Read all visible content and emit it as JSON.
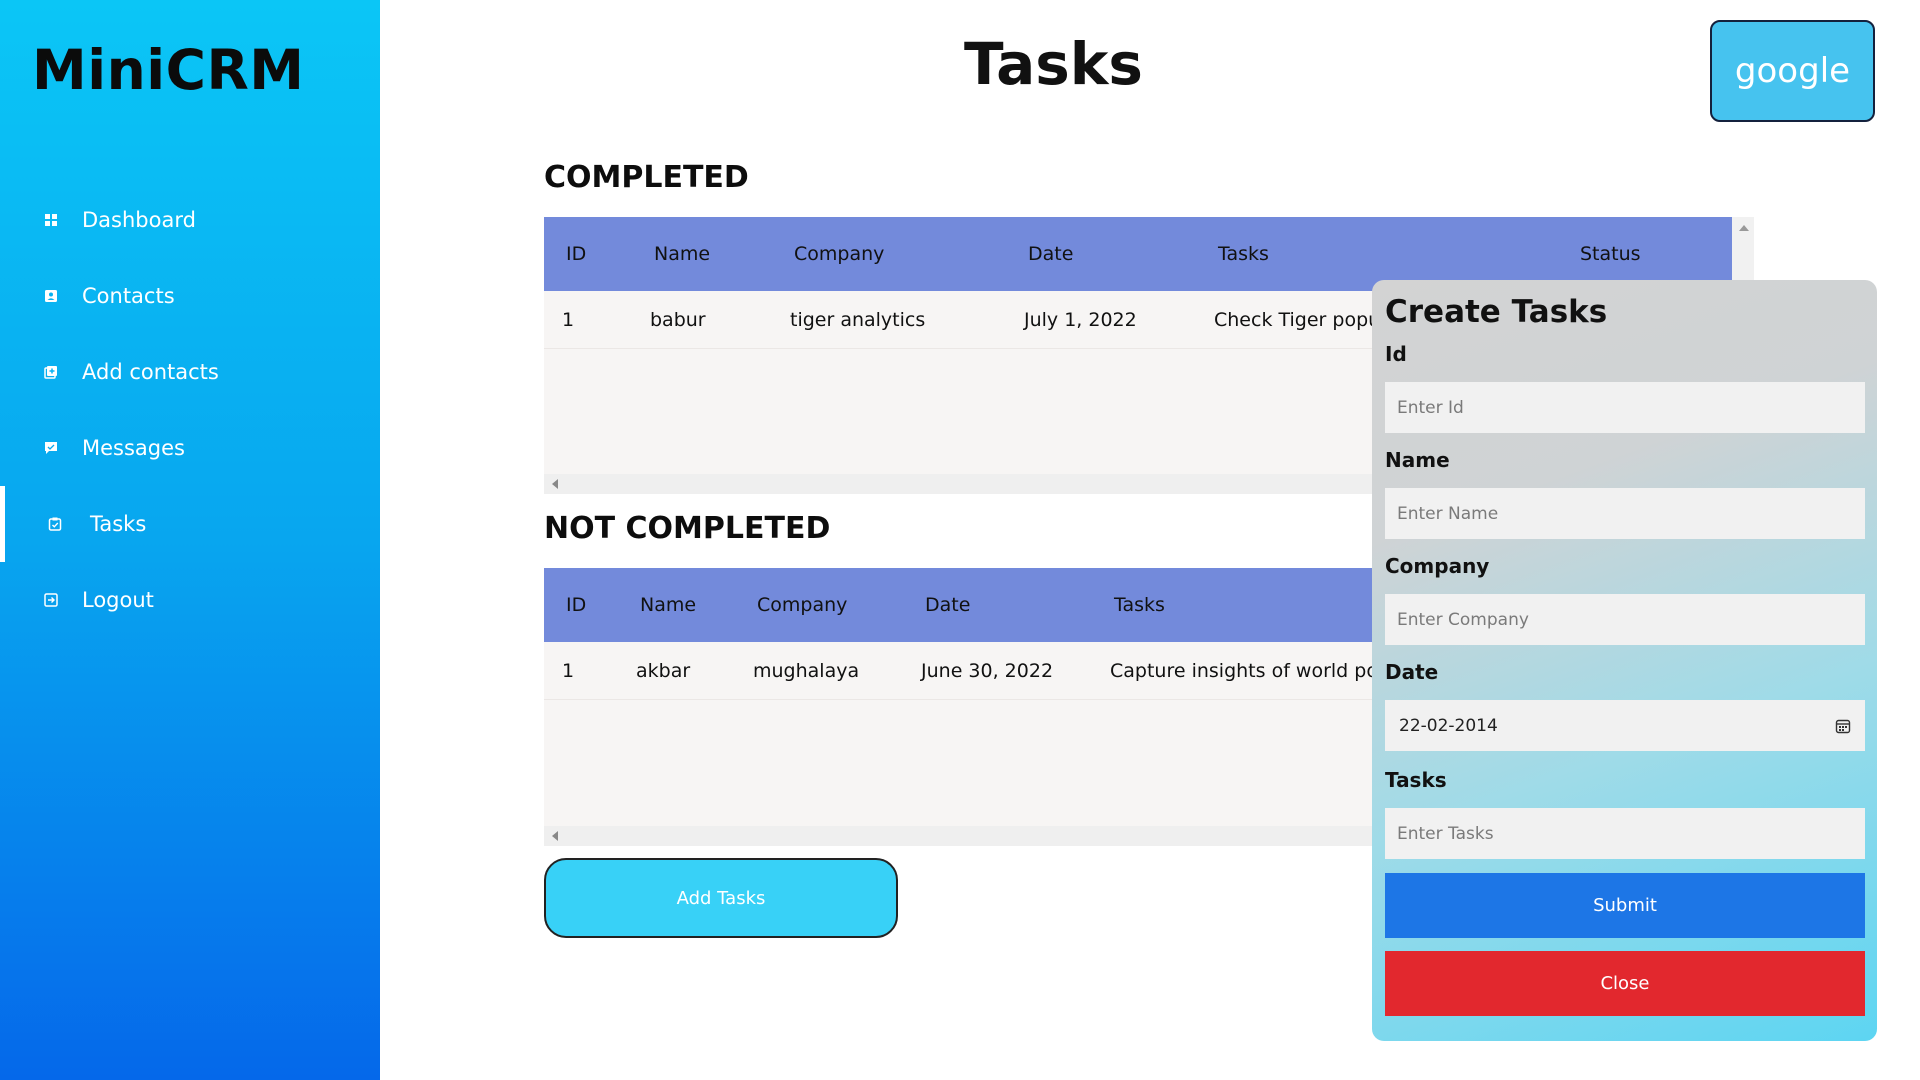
{
  "app": {
    "brand": "MiniCRM",
    "page_title": "Tasks",
    "google_button": "google"
  },
  "sidebar": {
    "items": [
      {
        "label": "Dashboard",
        "icon": "dashboard-icon"
      },
      {
        "label": "Contacts",
        "icon": "contact-card-icon"
      },
      {
        "label": "Add contacts",
        "icon": "add-contact-icon"
      },
      {
        "label": "Messages",
        "icon": "message-icon"
      },
      {
        "label": "Tasks",
        "icon": "task-clipboard-icon",
        "active": true
      },
      {
        "label": "Logout",
        "icon": "logout-icon"
      }
    ]
  },
  "completed": {
    "title": "COMPLETED",
    "headers": [
      "ID",
      "Name",
      "Company",
      "Date",
      "Tasks",
      "Status"
    ],
    "rows": [
      {
        "id": "1",
        "name": "babur",
        "company": "tiger analytics",
        "date": "July 1, 2022",
        "task": "Check Tiger popu"
      }
    ]
  },
  "not_completed": {
    "title": "NOT COMPLETED",
    "headers": [
      "ID",
      "Name",
      "Company",
      "Date",
      "Tasks"
    ],
    "rows": [
      {
        "id": "1",
        "name": "akbar",
        "company": "mughalaya",
        "date": "June 30, 2022",
        "task": "Capture insights of world po"
      }
    ]
  },
  "add_button": "Add Tasks",
  "modal": {
    "title": "Create Tasks",
    "fields": {
      "id": {
        "label": "Id",
        "placeholder": "Enter Id"
      },
      "name": {
        "label": "Name",
        "placeholder": "Enter Name"
      },
      "company": {
        "label": "Company",
        "placeholder": "Enter Company"
      },
      "date": {
        "label": "Date",
        "value": "22-02-2014"
      },
      "tasks": {
        "label": "Tasks",
        "placeholder": "Enter Tasks"
      }
    },
    "submit": "Submit",
    "close": "Close"
  },
  "colors": {
    "sidebar_top": "#0bc6f6",
    "sidebar_bottom": "#0568ea",
    "table_header": "#738adb",
    "submit": "#1d76e6",
    "close": "#e2282e",
    "add_button": "#38d1f7"
  }
}
